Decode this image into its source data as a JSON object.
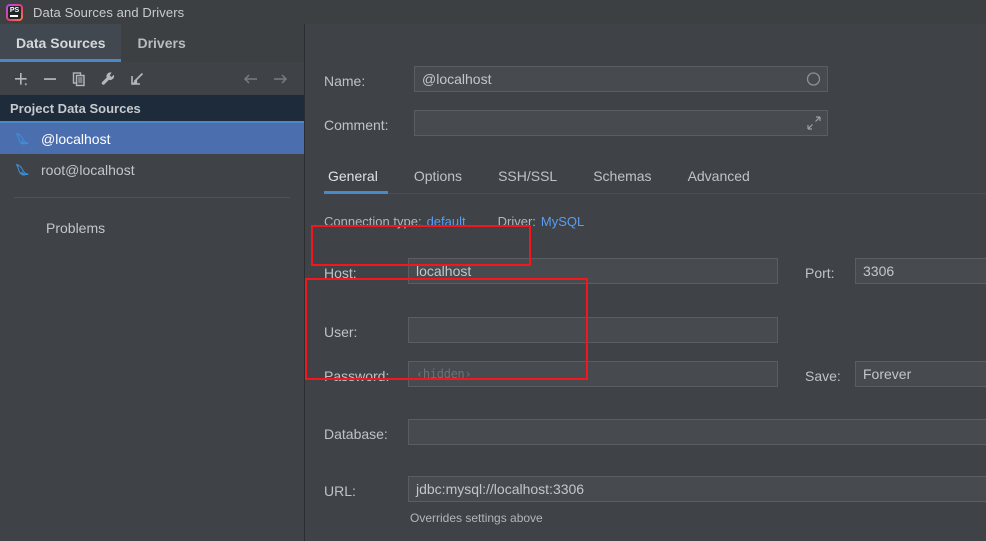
{
  "window": {
    "title": "Data Sources and Drivers",
    "app_icon": "phpstorm-logo-icon",
    "app_icon_text": "PS"
  },
  "left_panel": {
    "tabs": [
      {
        "label": "Data Sources",
        "active": true
      },
      {
        "label": "Drivers",
        "active": false
      }
    ],
    "toolbar": [
      {
        "name": "add-icon",
        "glyph": "+"
      },
      {
        "name": "remove-icon",
        "glyph": "−"
      },
      {
        "name": "copy-icon",
        "glyph": "copy"
      },
      {
        "name": "wrench-icon",
        "glyph": "wrench"
      },
      {
        "name": "import-icon",
        "glyph": "import-arrow"
      },
      {
        "name": "back-arrow-icon",
        "glyph": "←"
      },
      {
        "name": "forward-arrow-icon",
        "glyph": "→"
      }
    ],
    "group_header": "Project Data Sources",
    "items": [
      {
        "label": "@localhost",
        "icon": "mysql-dolphin-icon",
        "selected": true
      },
      {
        "label": "root@localhost",
        "icon": "mysql-dolphin-icon",
        "selected": false
      }
    ],
    "problems_label": "Problems"
  },
  "details": {
    "name_label": "Name:",
    "name_value": "@localhost",
    "name_color_icon": "color-circle-icon",
    "comment_label": "Comment:",
    "comment_value": "",
    "comment_expand_icon": "expand-diagonal-icon",
    "tabs": [
      {
        "label": "General",
        "active": true
      },
      {
        "label": "Options",
        "active": false
      },
      {
        "label": "SSH/SSL",
        "active": false
      },
      {
        "label": "Schemas",
        "active": false
      },
      {
        "label": "Advanced",
        "active": false
      }
    ],
    "connection_type_label": "Connection type:",
    "connection_type_value": "default",
    "driver_label": "Driver:",
    "driver_value": "MySQL",
    "host_label": "Host:",
    "host_value": "localhost",
    "port_label": "Port:",
    "port_value": "3306",
    "user_label": "User:",
    "user_value": "",
    "password_label": "Password:",
    "password_placeholder": "‹hidden›",
    "save_label": "Save:",
    "save_value": "Forever",
    "database_label": "Database:",
    "database_value": "",
    "url_label": "URL:",
    "url_value": "jdbc:mysql://localhost:3306",
    "url_hint": "Overrides settings above"
  },
  "annotations": {
    "highlight_color": "#f5151d",
    "boxes": [
      {
        "name": "host-highlight-box"
      },
      {
        "name": "credentials-highlight-box"
      }
    ]
  }
}
